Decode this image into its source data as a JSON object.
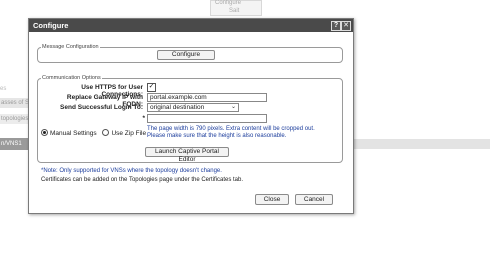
{
  "background": {
    "top_tab_1": "Configure",
    "top_tab_2": "Sait",
    "left_1": "es",
    "left_2": "asses of S",
    "left_3": "topologies",
    "left_4": "n/VNS1"
  },
  "dialog": {
    "title": "Configure",
    "help_glyph": "?",
    "close_glyph": "✕",
    "message_section": {
      "legend": "Message Configuration",
      "configure_button": "Configure"
    },
    "communication_section": {
      "legend": "Communication Options",
      "https_label": "Use HTTPS for User Connections:",
      "https_checked": true,
      "https_check_glyph": "✓",
      "replace_label": "Replace Gateway IP with FQDN:",
      "replace_value": "portal.example.com",
      "login_label": "Send Successful Login To:",
      "login_value": "original destination",
      "login_arrow": "⌄",
      "star": "*",
      "url_value": "",
      "manual_settings_label": "Manual Settings",
      "use_zip_label": "Use Zip File",
      "info_line1": "The page width is 790 pixels. Extra content will be cropped out.",
      "info_line2": "Please make sure that the height is also reasonable.",
      "portal_button": "Launch Captive Portal Editor"
    },
    "note_line1": "*Note: Only supported for VNSs where the topology doesn't change.",
    "note_line2": "Certificates can be added on the Topologies page under the Certificates tab.",
    "close_button": "Close",
    "cancel_button": "Cancel"
  }
}
